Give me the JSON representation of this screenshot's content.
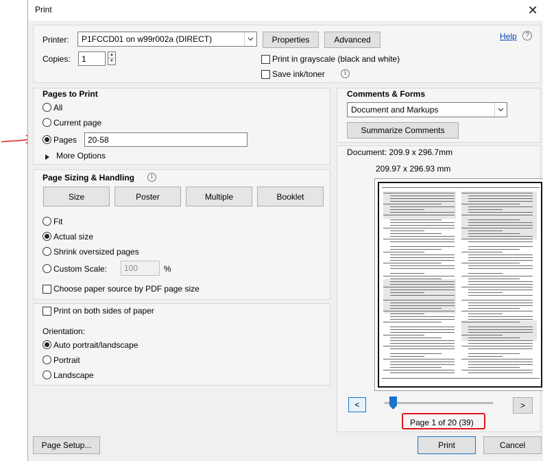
{
  "window": {
    "title": "Print",
    "close_glyph": "✕"
  },
  "printer": {
    "printer_label": "Printer:",
    "printer_value": "P1FCCD01 on w99r002a (DIRECT)",
    "properties_label": "Properties",
    "advanced_label": "Advanced",
    "help_label": "Help",
    "copies_label": "Copies:",
    "copies_value": "1",
    "grayscale_label": "Print in grayscale (black and white)",
    "save_ink_label": "Save ink/toner"
  },
  "pages_to_print": {
    "heading": "Pages to Print",
    "all_label": "All",
    "current_label": "Current page",
    "pages_label": "Pages",
    "pages_value": "20-58",
    "more_options_label": "More Options",
    "selected": "pages"
  },
  "sizing": {
    "heading": "Page Sizing & Handling",
    "tabs": [
      "Size",
      "Poster",
      "Multiple",
      "Booklet"
    ],
    "fit_label": "Fit",
    "actual_label": "Actual size",
    "shrink_label": "Shrink oversized pages",
    "custom_label": "Custom Scale:",
    "custom_value": "100",
    "custom_unit": "%",
    "paper_source_label": "Choose paper source by PDF page size",
    "selected": "actual"
  },
  "duplex": {
    "both_sides_label": "Print on both sides of paper",
    "orientation_label": "Orientation:",
    "auto_label": "Auto portrait/landscape",
    "portrait_label": "Portrait",
    "landscape_label": "Landscape",
    "selected": "auto"
  },
  "comments": {
    "heading": "Comments & Forms",
    "select_value": "Document and Markups",
    "summarize_label": "Summarize Comments"
  },
  "preview": {
    "document_size": "Document: 209.9 x 296.7mm",
    "page_size": "209.97 x 296.93 mm",
    "page_indicator": "Page 1 of 20 (39)",
    "prev_glyph": "<",
    "next_glyph": ">",
    "slider_fraction": 0.05
  },
  "footer": {
    "page_setup_label": "Page Setup...",
    "print_label": "Print",
    "cancel_label": "Cancel"
  },
  "colors": {
    "annotation_red": "#e0161b",
    "slider_blue": "#1a73c9"
  }
}
